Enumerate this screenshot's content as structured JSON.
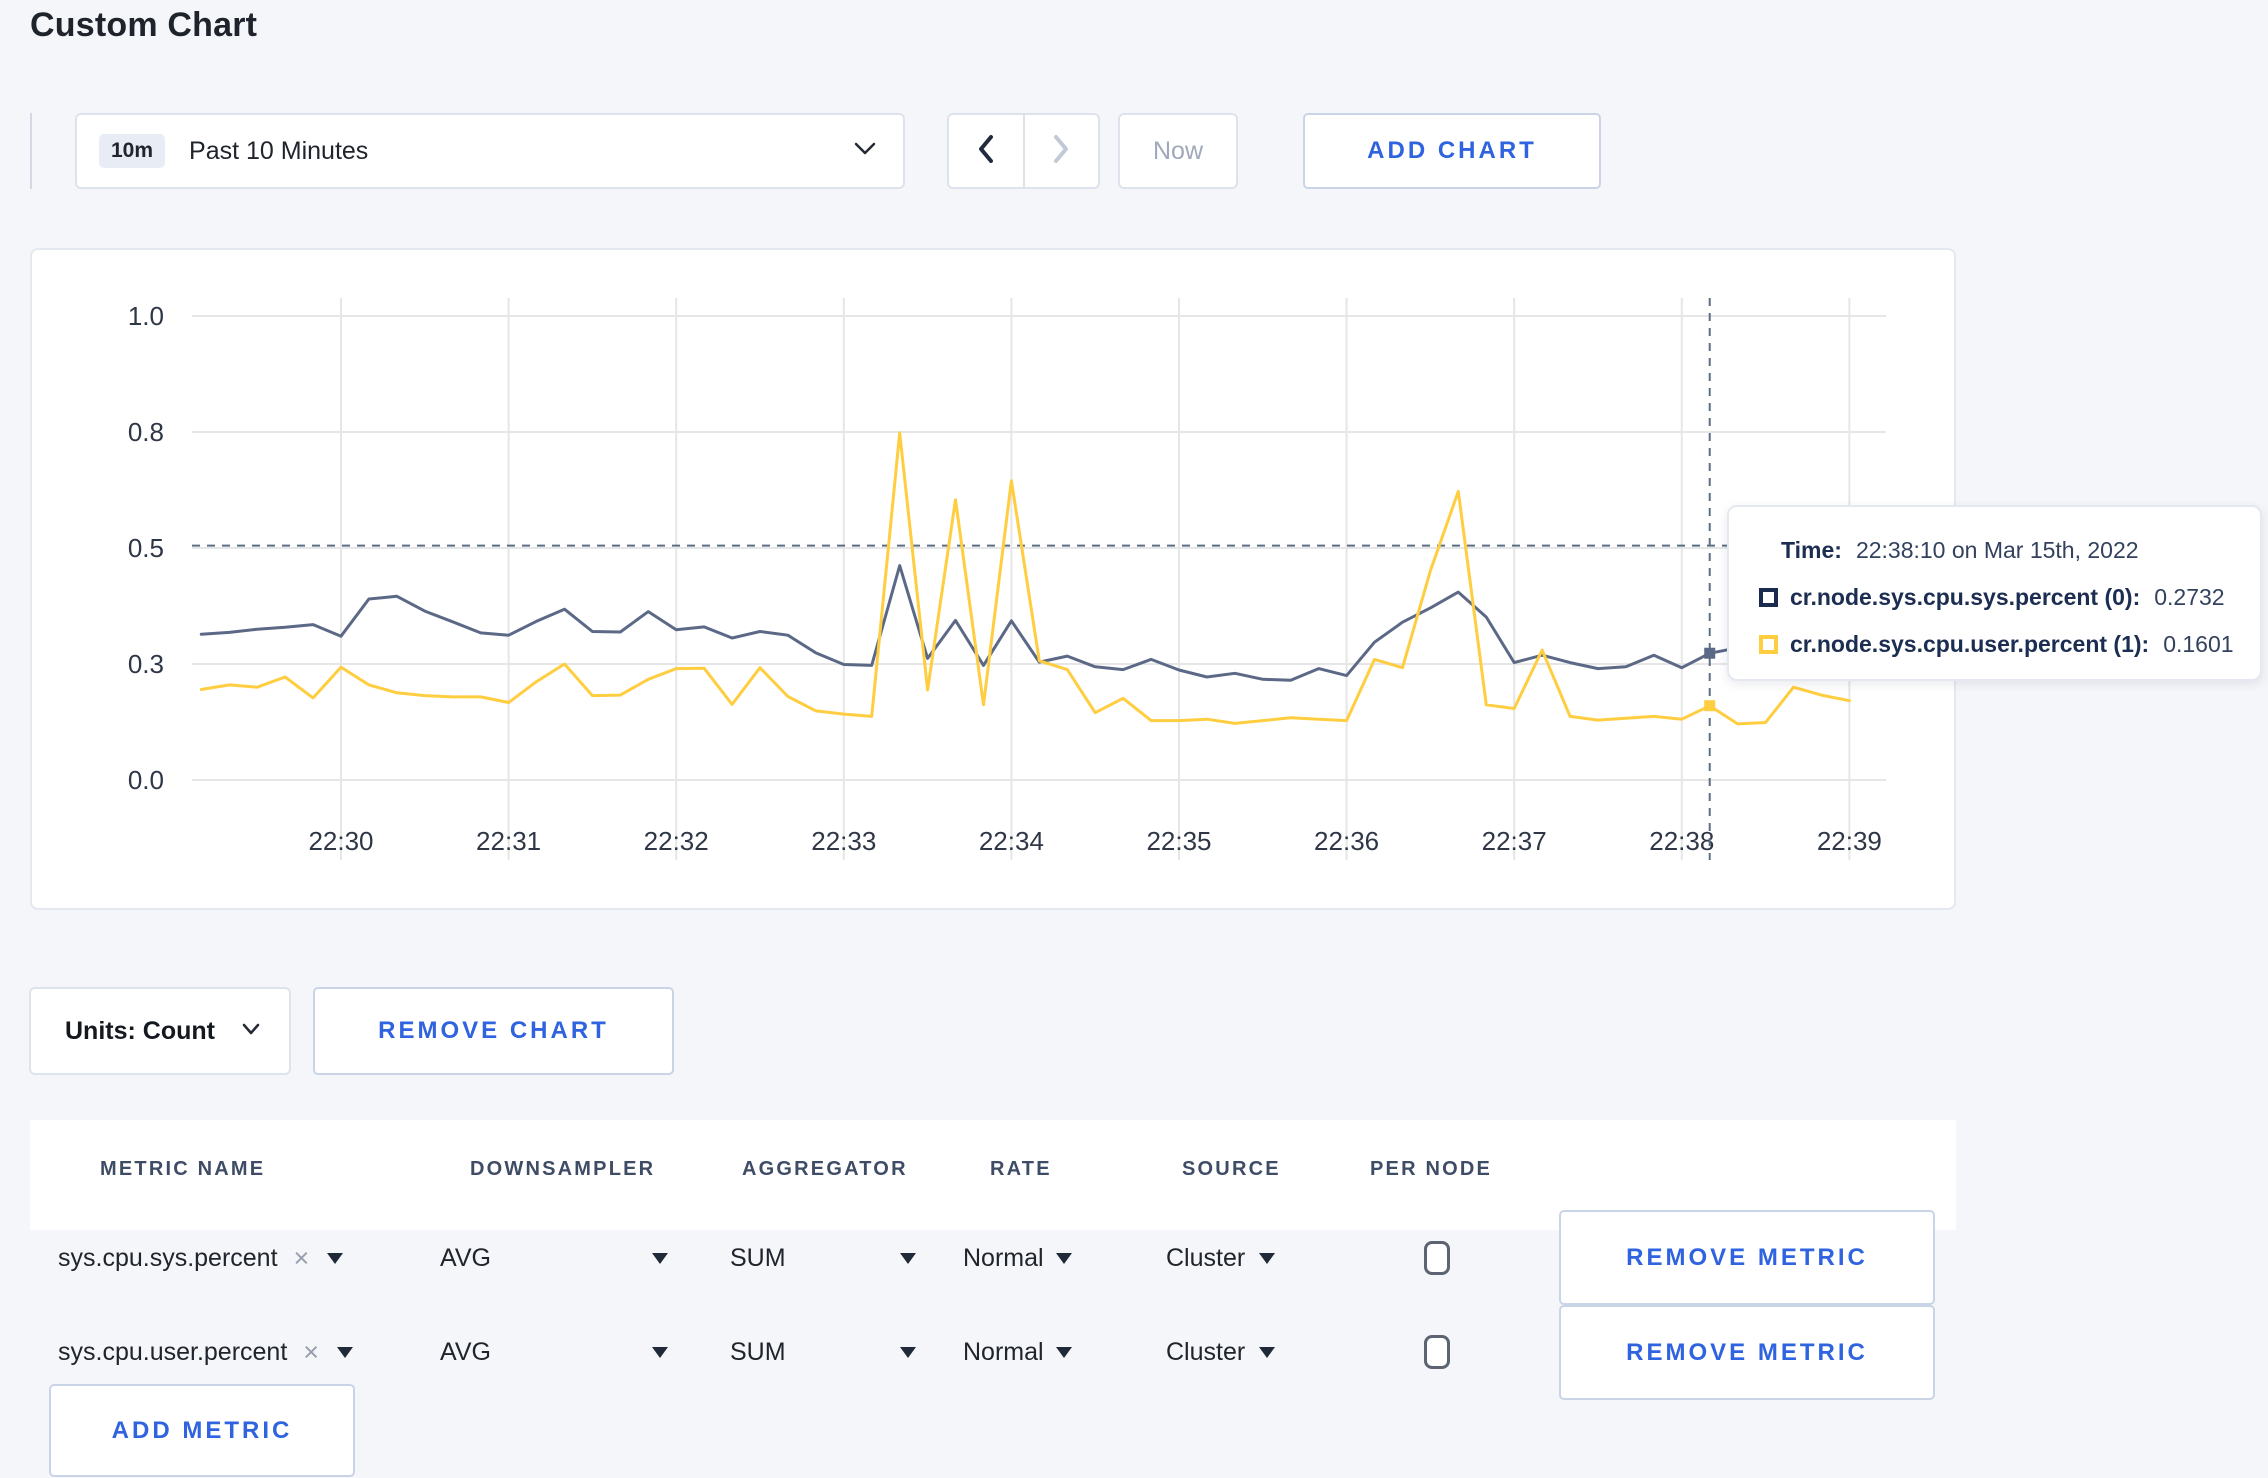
{
  "title": "Custom Chart",
  "toolbar": {
    "time_window_badge": "10m",
    "time_window_label": "Past 10 Minutes",
    "now_label": "Now",
    "add_chart_label": "ADD CHART"
  },
  "chart_data": {
    "type": "line",
    "xlabel": "",
    "ylabel": "",
    "ylim": [
      0,
      1
    ],
    "grid": true,
    "y_ticks": [
      {
        "v": 0,
        "label": "0.0"
      },
      {
        "v": 0.25,
        "label": "0.3"
      },
      {
        "v": 0.5,
        "label": "0.5"
      },
      {
        "v": 0.75,
        "label": "0.8"
      },
      {
        "v": 1,
        "label": "1.0"
      }
    ],
    "x_ticks": [
      {
        "s": 60,
        "label": "22:30"
      },
      {
        "s": 120,
        "label": "22:31"
      },
      {
        "s": 180,
        "label": "22:32"
      },
      {
        "s": 240,
        "label": "22:33"
      },
      {
        "s": 300,
        "label": "22:34"
      },
      {
        "s": 360,
        "label": "22:35"
      },
      {
        "s": 420,
        "label": "22:36"
      },
      {
        "s": 480,
        "label": "22:37"
      },
      {
        "s": 540,
        "label": "22:38"
      },
      {
        "s": 600,
        "label": "22:39"
      }
    ],
    "x_seconds": [
      10,
      20,
      30,
      40,
      50,
      60,
      70,
      80,
      90,
      100,
      110,
      120,
      130,
      140,
      150,
      160,
      170,
      180,
      190,
      200,
      210,
      220,
      230,
      240,
      250,
      260,
      270,
      280,
      290,
      300,
      310,
      320,
      330,
      340,
      350,
      360,
      370,
      380,
      390,
      400,
      410,
      420,
      430,
      440,
      450,
      460,
      470,
      480,
      490,
      500,
      510,
      520,
      530,
      540,
      550,
      560,
      570,
      580,
      590,
      600
    ],
    "series": [
      {
        "name": "cr.node.sys.cpu.sys.percent",
        "color": "#5b6987",
        "values": [
          0.314,
          0.318,
          0.325,
          0.329,
          0.335,
          0.31,
          0.39,
          0.396,
          0.364,
          0.341,
          0.317,
          0.312,
          0.342,
          0.368,
          0.32,
          0.319,
          0.363,
          0.324,
          0.33,
          0.306,
          0.32,
          0.312,
          0.274,
          0.249,
          0.247,
          0.462,
          0.262,
          0.344,
          0.247,
          0.343,
          0.254,
          0.267,
          0.244,
          0.238,
          0.26,
          0.237,
          0.222,
          0.23,
          0.217,
          0.215,
          0.24,
          0.225,
          0.297,
          0.34,
          0.371,
          0.405,
          0.351,
          0.253,
          0.269,
          0.253,
          0.24,
          0.244,
          0.269,
          0.242,
          0.273,
          0.285,
          0.3,
          0.285,
          0.295,
          0.3
        ]
      },
      {
        "name": "cr.node.sys.cpu.user.percent",
        "color": "#ffcd40",
        "values": [
          0.195,
          0.205,
          0.2,
          0.222,
          0.177,
          0.243,
          0.205,
          0.188,
          0.182,
          0.179,
          0.179,
          0.167,
          0.212,
          0.25,
          0.182,
          0.183,
          0.217,
          0.24,
          0.241,
          0.163,
          0.242,
          0.18,
          0.149,
          0.142,
          0.137,
          0.748,
          0.194,
          0.604,
          0.162,
          0.645,
          0.257,
          0.238,
          0.145,
          0.176,
          0.128,
          0.128,
          0.131,
          0.122,
          0.128,
          0.134,
          0.131,
          0.128,
          0.26,
          0.242,
          0.451,
          0.622,
          0.162,
          0.154,
          0.28,
          0.137,
          0.129,
          0.133,
          0.137,
          0.131,
          0.16,
          0.121,
          0.124,
          0.2,
          0.183,
          0.171
        ]
      }
    ],
    "crosshair": {
      "x_seconds": 550,
      "y_value": 0.505,
      "marker_values": [
        0.2732,
        0.1601
      ]
    },
    "legend_position": "tooltip"
  },
  "tooltip": {
    "time_label": "Time:",
    "time_value": "22:38:10 on Mar 15th, 2022",
    "rows": [
      {
        "label": "cr.node.sys.cpu.sys.percent (0):",
        "value": "0.2732",
        "swatch_color": "#1b2b4f"
      },
      {
        "label": "cr.node.sys.cpu.user.percent (1):",
        "value": "0.1601",
        "swatch_color": "#ffcd40"
      }
    ]
  },
  "units_bar": {
    "units_label": "Units: Count",
    "remove_chart_label": "REMOVE CHART"
  },
  "metric_table": {
    "headers": [
      "METRIC NAME",
      "DOWNSAMPLER",
      "AGGREGATOR",
      "RATE",
      "SOURCE",
      "PER NODE"
    ],
    "rows": [
      {
        "metric": "sys.cpu.sys.percent",
        "downsampler": "AVG",
        "aggregator": "SUM",
        "rate": "Normal",
        "source": "Cluster",
        "per_node_checked": false,
        "remove_label": "REMOVE METRIC"
      },
      {
        "metric": "sys.cpu.user.percent",
        "downsampler": "AVG",
        "aggregator": "SUM",
        "rate": "Normal",
        "source": "Cluster",
        "per_node_checked": false,
        "remove_label": "REMOVE METRIC"
      }
    ],
    "add_metric_label": "ADD METRIC"
  },
  "colors": {
    "accent_blue": "#2f63e0",
    "series_sys": "#5b6987",
    "series_user": "#ffcd40",
    "crosshair": "#5c6e84",
    "gridline": "#e6e6e6"
  }
}
